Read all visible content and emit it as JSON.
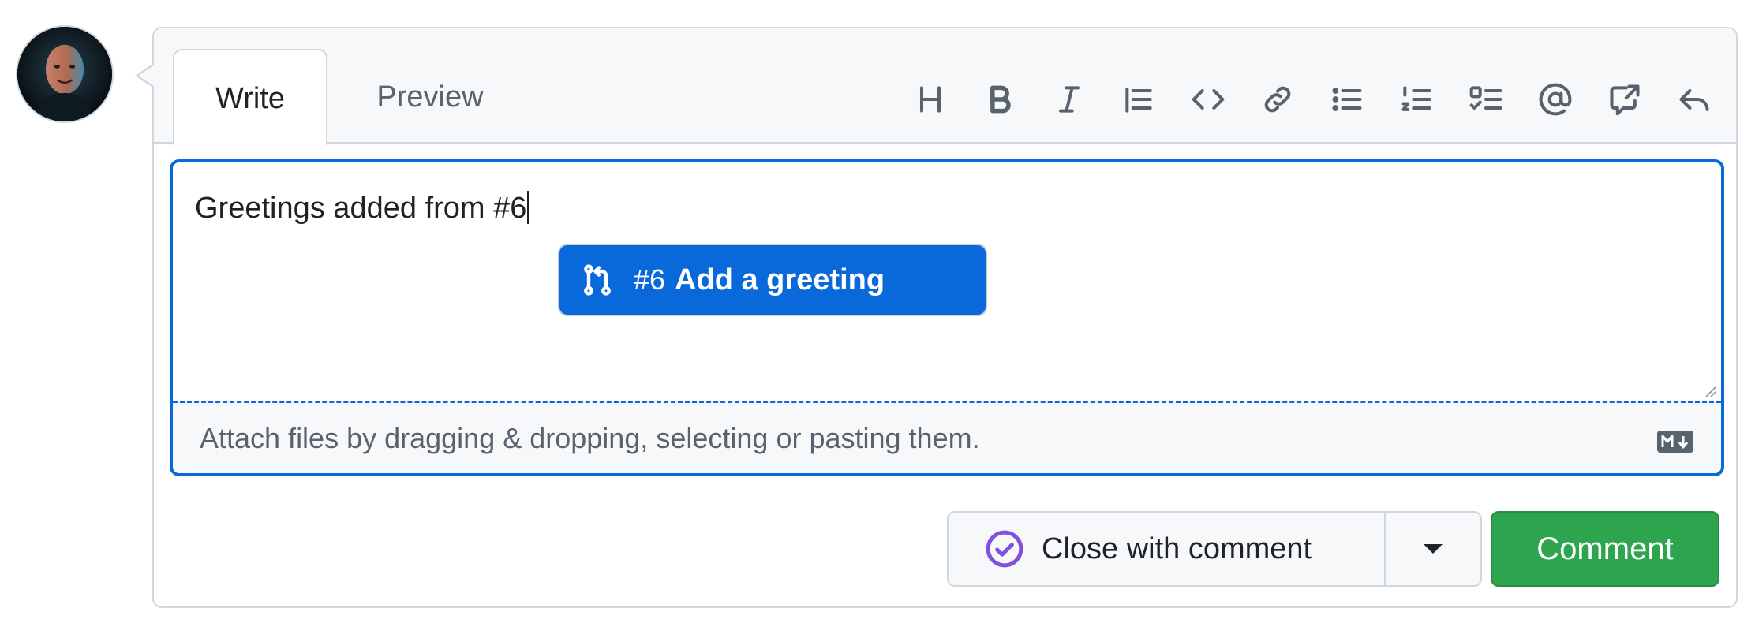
{
  "tabs": {
    "write": "Write",
    "preview": "Preview"
  },
  "toolbar": {
    "icons": [
      "heading-icon",
      "bold-icon",
      "italic-icon",
      "quote-icon",
      "code-icon",
      "link-icon",
      "unordered-list-icon",
      "ordered-list-icon",
      "task-list-icon",
      "mention-icon",
      "cross-reference-icon",
      "reply-icon"
    ]
  },
  "editor": {
    "text": "Greetings added from #6",
    "attach_hint": "Attach files by dragging & dropping, selecting or pasting them."
  },
  "suggestion": {
    "number": "#6",
    "title": "Add a greeting",
    "icon": "pull-request-icon"
  },
  "actions": {
    "close_label": "Close with comment",
    "comment_label": "Comment"
  },
  "colors": {
    "accent": "#0969da",
    "success": "#2da44e",
    "done_purple": "#8250df"
  }
}
